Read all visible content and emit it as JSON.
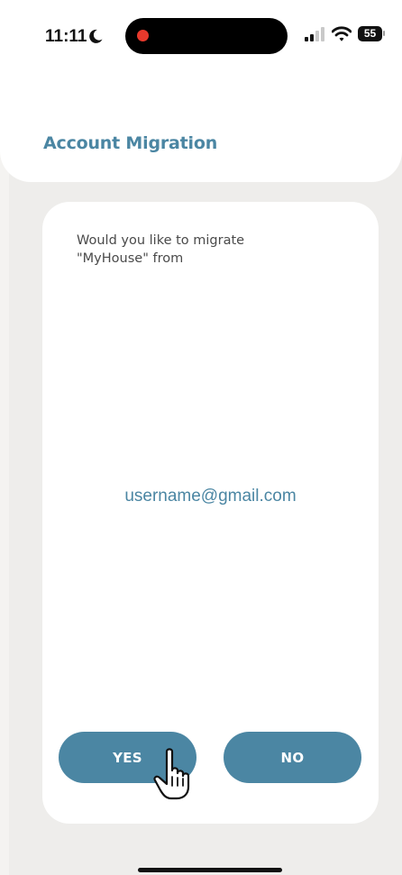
{
  "status_bar": {
    "time": "11:11",
    "battery": "55",
    "icons": [
      "moon-icon",
      "recording-dot-icon",
      "cellular-signal-icon",
      "wifi-icon",
      "battery-icon"
    ]
  },
  "header": {
    "title": "Account Migration"
  },
  "dialog": {
    "prompt_line1": "Would you like to migrate",
    "prompt_line2": "\"MyHouse\" from",
    "email": "username@gmail.com",
    "yes_label": "YES",
    "no_label": "NO"
  },
  "colors": {
    "accent": "#4b86a3",
    "background": "#eeedeb",
    "card": "#ffffff",
    "recording": "#e8392c"
  },
  "cursor": "hand-pointer-icon"
}
